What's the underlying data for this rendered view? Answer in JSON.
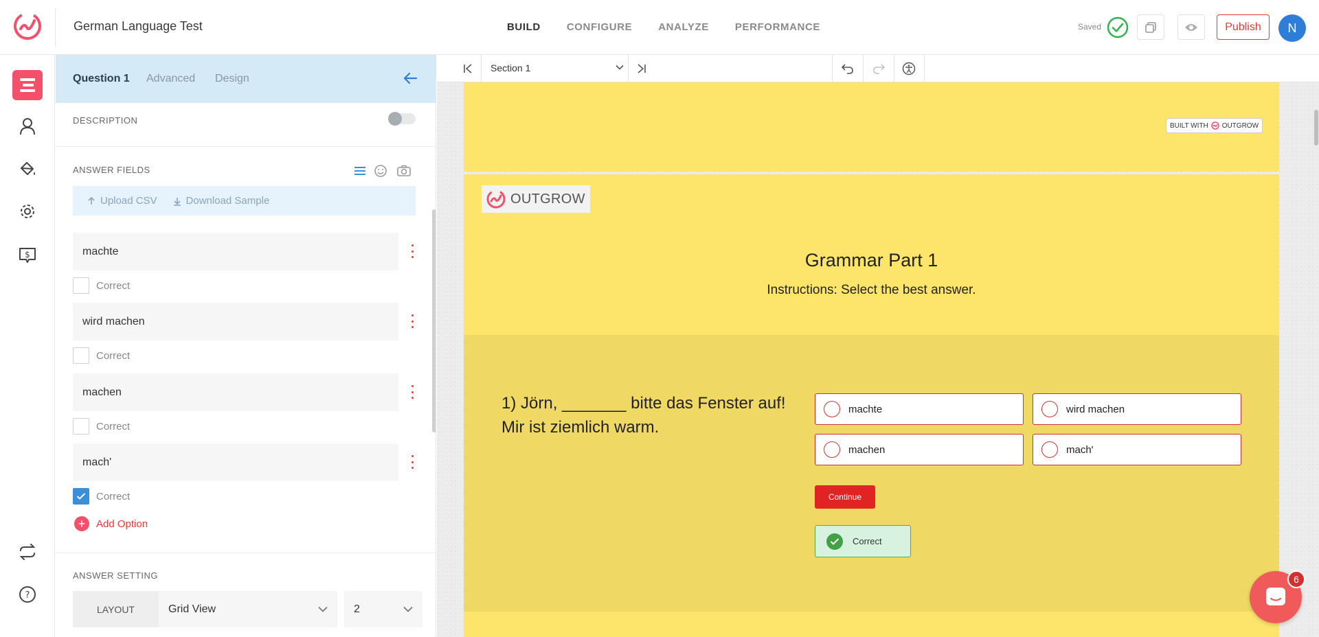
{
  "app": {
    "title": "German Language Test"
  },
  "nav": [
    {
      "label": "BUILD",
      "active": true
    },
    {
      "label": "CONFIGURE",
      "active": false
    },
    {
      "label": "ANALYZE",
      "active": false
    },
    {
      "label": "PERFORMANCE",
      "active": false
    }
  ],
  "status": {
    "saved_label": "Saved"
  },
  "header": {
    "publish_label": "Publish",
    "avatar_initial": "N"
  },
  "rail": {
    "icons": [
      "content-icon",
      "user-icon",
      "paint-bucket-icon",
      "gear-icon",
      "pricing-icon",
      "sync-icon",
      "help-icon"
    ]
  },
  "panel": {
    "tabs": [
      {
        "label": "Question 1",
        "active": true
      },
      {
        "label": "Advanced",
        "active": false
      },
      {
        "label": "Design",
        "active": false
      }
    ],
    "description_label": "DESCRIPTION",
    "description_enabled": false,
    "answer_fields_label": "ANSWER FIELDS",
    "upload_csv_label": "Upload CSV",
    "download_sample_label": "Download Sample",
    "answers": [
      {
        "value": "machte",
        "correct": false
      },
      {
        "value": "wird machen",
        "correct": false
      },
      {
        "value": "machen",
        "correct": false
      },
      {
        "value": "mach'",
        "correct": true
      }
    ],
    "correct_label": "Correct",
    "add_option_label": "Add Option",
    "answer_setting_label": "ANSWER SETTING",
    "layout_label": "LAYOUT",
    "layout_value": "Grid View",
    "columns_value": "2"
  },
  "preview": {
    "section_value": "Section 1",
    "built_with_label": "BUILT WITH",
    "brand_name": "OUTGROW",
    "card": {
      "logo_text": "OUTGROW",
      "title": "Grammar Part 1",
      "subtitle": "Instructions: Select the best answer.",
      "question_line1": "1) Jörn, _______ bitte das Fenster auf!",
      "question_line2": "Mir ist ziemlich warm.",
      "options": [
        "machte",
        "wird machen",
        "machen",
        "mach'"
      ],
      "continue_label": "Continue",
      "feedback_label": "Correct"
    }
  },
  "chat": {
    "badge_count": "6"
  },
  "colors": {
    "accent": "#e53935",
    "brand_pink": "#f4506a",
    "quiz_yellow": "#fde56b",
    "panel_blue": "#d4eaf7"
  }
}
